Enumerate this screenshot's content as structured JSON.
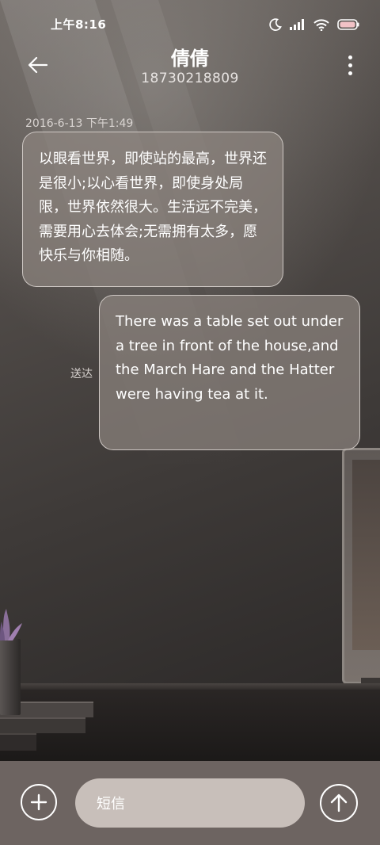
{
  "status_bar": {
    "time": "上午8:16",
    "icons": [
      "moon-icon",
      "signal-icon",
      "wifi-icon",
      "battery-icon"
    ]
  },
  "header": {
    "back_icon": "arrow-left-icon",
    "contact_name": "倩倩",
    "phone_number": "18730218809",
    "more_icon": "more-vertical-icon"
  },
  "conversation": {
    "timestamp": "2016-6-13 下午1:49",
    "messages": [
      {
        "direction": "incoming",
        "text": "以眼看世界，即使站的最高，世界还是很小;以心看世界，即使身处局限，世界依然很大。生活远不完美，需要用心去体会;无需拥有太多，愿快乐与你相随。"
      },
      {
        "direction": "outgoing",
        "text": "There was a table set out under a tree in front of the house,and the March Hare and the Hatter were having tea at it.",
        "status": "送达"
      }
    ]
  },
  "composer": {
    "add_icon": "plus-icon",
    "placeholder": "短信",
    "send_icon": "arrow-up-icon"
  },
  "colors": {
    "bubble_bg": "#8c837e",
    "composer_bg": "#6d6461",
    "input_bg": "#c8bfba"
  }
}
